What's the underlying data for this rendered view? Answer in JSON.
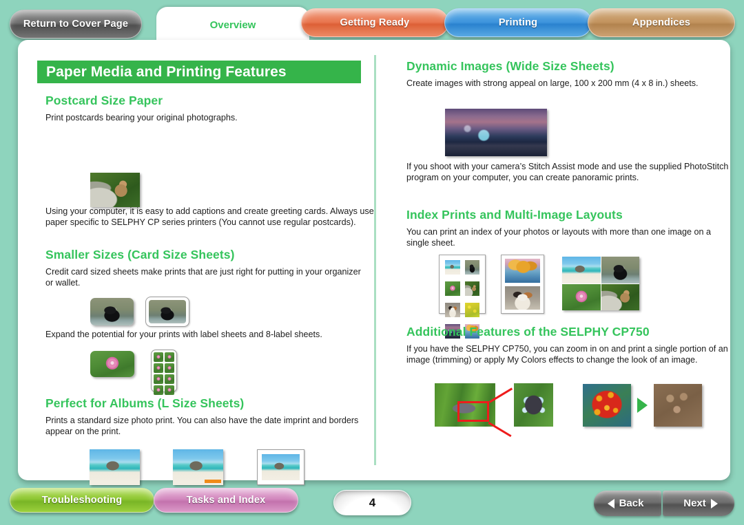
{
  "nav_tabs": {
    "return_cover": "Return to Cover Page",
    "overview": "Overview",
    "getting_ready": "Getting Ready",
    "printing": "Printing",
    "appendices": "Appendices"
  },
  "page": {
    "title": "Paper Media and Printing Features",
    "number": "4"
  },
  "left_column": {
    "sections": [
      {
        "heading": "Postcard Size Paper",
        "intro": "Print postcards bearing your original photographs.",
        "outro": "Using your computer, it is easy to add captions and create greeting cards. Always use paper specific to SELPHY CP series printers (You cannot use regular postcards)."
      },
      {
        "heading": "Smaller Sizes (Card Size Sheets)",
        "intro": "Credit card sized sheets make prints that are just right for putting in your organizer or wallet.",
        "outro": "Expand the potential for your prints with label sheets and 8-label sheets."
      },
      {
        "heading": "Perfect for Albums (L Size Sheets)",
        "intro": "Prints a standard size photo print. You can also have the date imprint and borders appear on the print."
      }
    ]
  },
  "right_column": {
    "sections": [
      {
        "heading": "Dynamic Images (Wide Size Sheets)",
        "intro": "Create images with strong appeal on large, 100 x 200 mm (4 x 8 in.) sheets.",
        "outro": "If you shoot with your camera’s Stitch Assist mode and use the supplied PhotoStitch program on your computer, you can create panoramic prints."
      },
      {
        "heading": "Index Prints and Multi-Image Layouts",
        "intro": "You can print an index of your photos or layouts with more than one image on a single sheet."
      },
      {
        "heading": "Additional Features of the SELPHY CP750",
        "intro": "If you have the SELPHY CP750, you can zoom in on and print a single portion of an image (trimming) or apply My Colors effects to change the look of an image."
      }
    ]
  },
  "footer": {
    "troubleshooting": "Troubleshooting",
    "tasks_and_index": "Tasks and Index",
    "back": "Back",
    "next": "Next"
  },
  "colors": {
    "page_background": "#8ed4bd",
    "title_band": "#35b44a",
    "heading_green": "#35c45c",
    "tab_getting_ready": "#e9764f",
    "tab_printing": "#3f95dd",
    "tab_appendices": "#c3945f",
    "btn_troubleshooting": "#8dc631",
    "btn_tasks_index": "#d287bd",
    "divider": "#aadfc2"
  }
}
